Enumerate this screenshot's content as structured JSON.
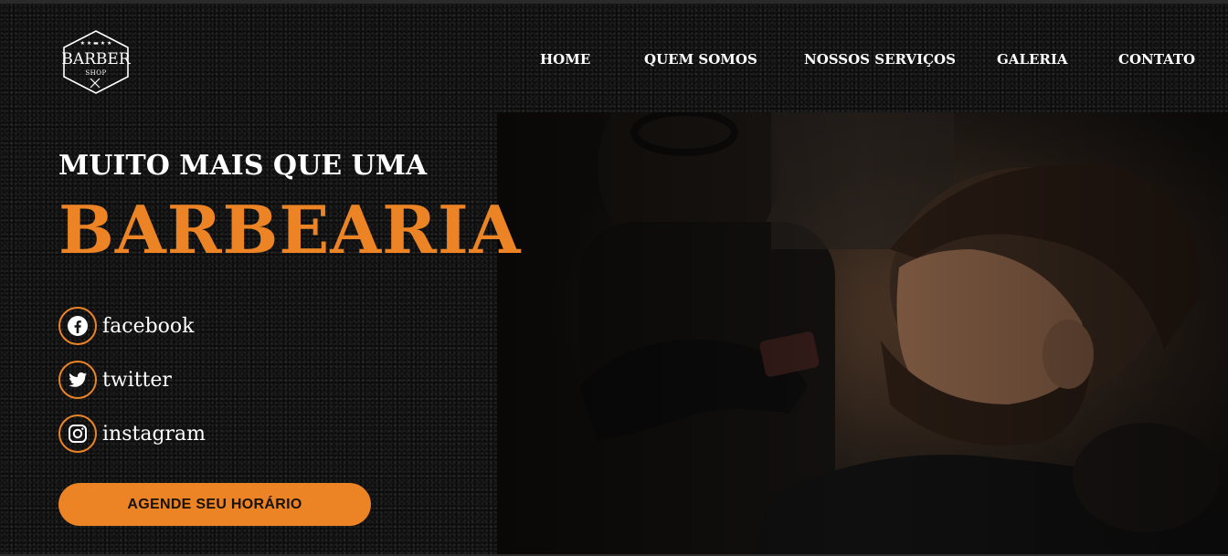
{
  "brand": {
    "logo_main": "BARBER",
    "logo_sub": "SHOP",
    "accent_color": "#ec8425"
  },
  "nav": {
    "items": [
      "HOME",
      "QUEM SOMOS",
      "NOSSOS SERVIÇOS",
      "GALERIA",
      "CONTATO"
    ]
  },
  "hero": {
    "tagline": "MUITO MAIS QUE UMA",
    "headline": "BARBEARIA",
    "image_alt_icon": "barber-photo"
  },
  "social": [
    {
      "label": "facebook",
      "icon": "facebook-icon"
    },
    {
      "label": "twitter",
      "icon": "twitter-icon"
    },
    {
      "label": "instagram",
      "icon": "instagram-icon"
    }
  ],
  "cta": {
    "label": "AGENDE SEU HORÁRIO"
  }
}
